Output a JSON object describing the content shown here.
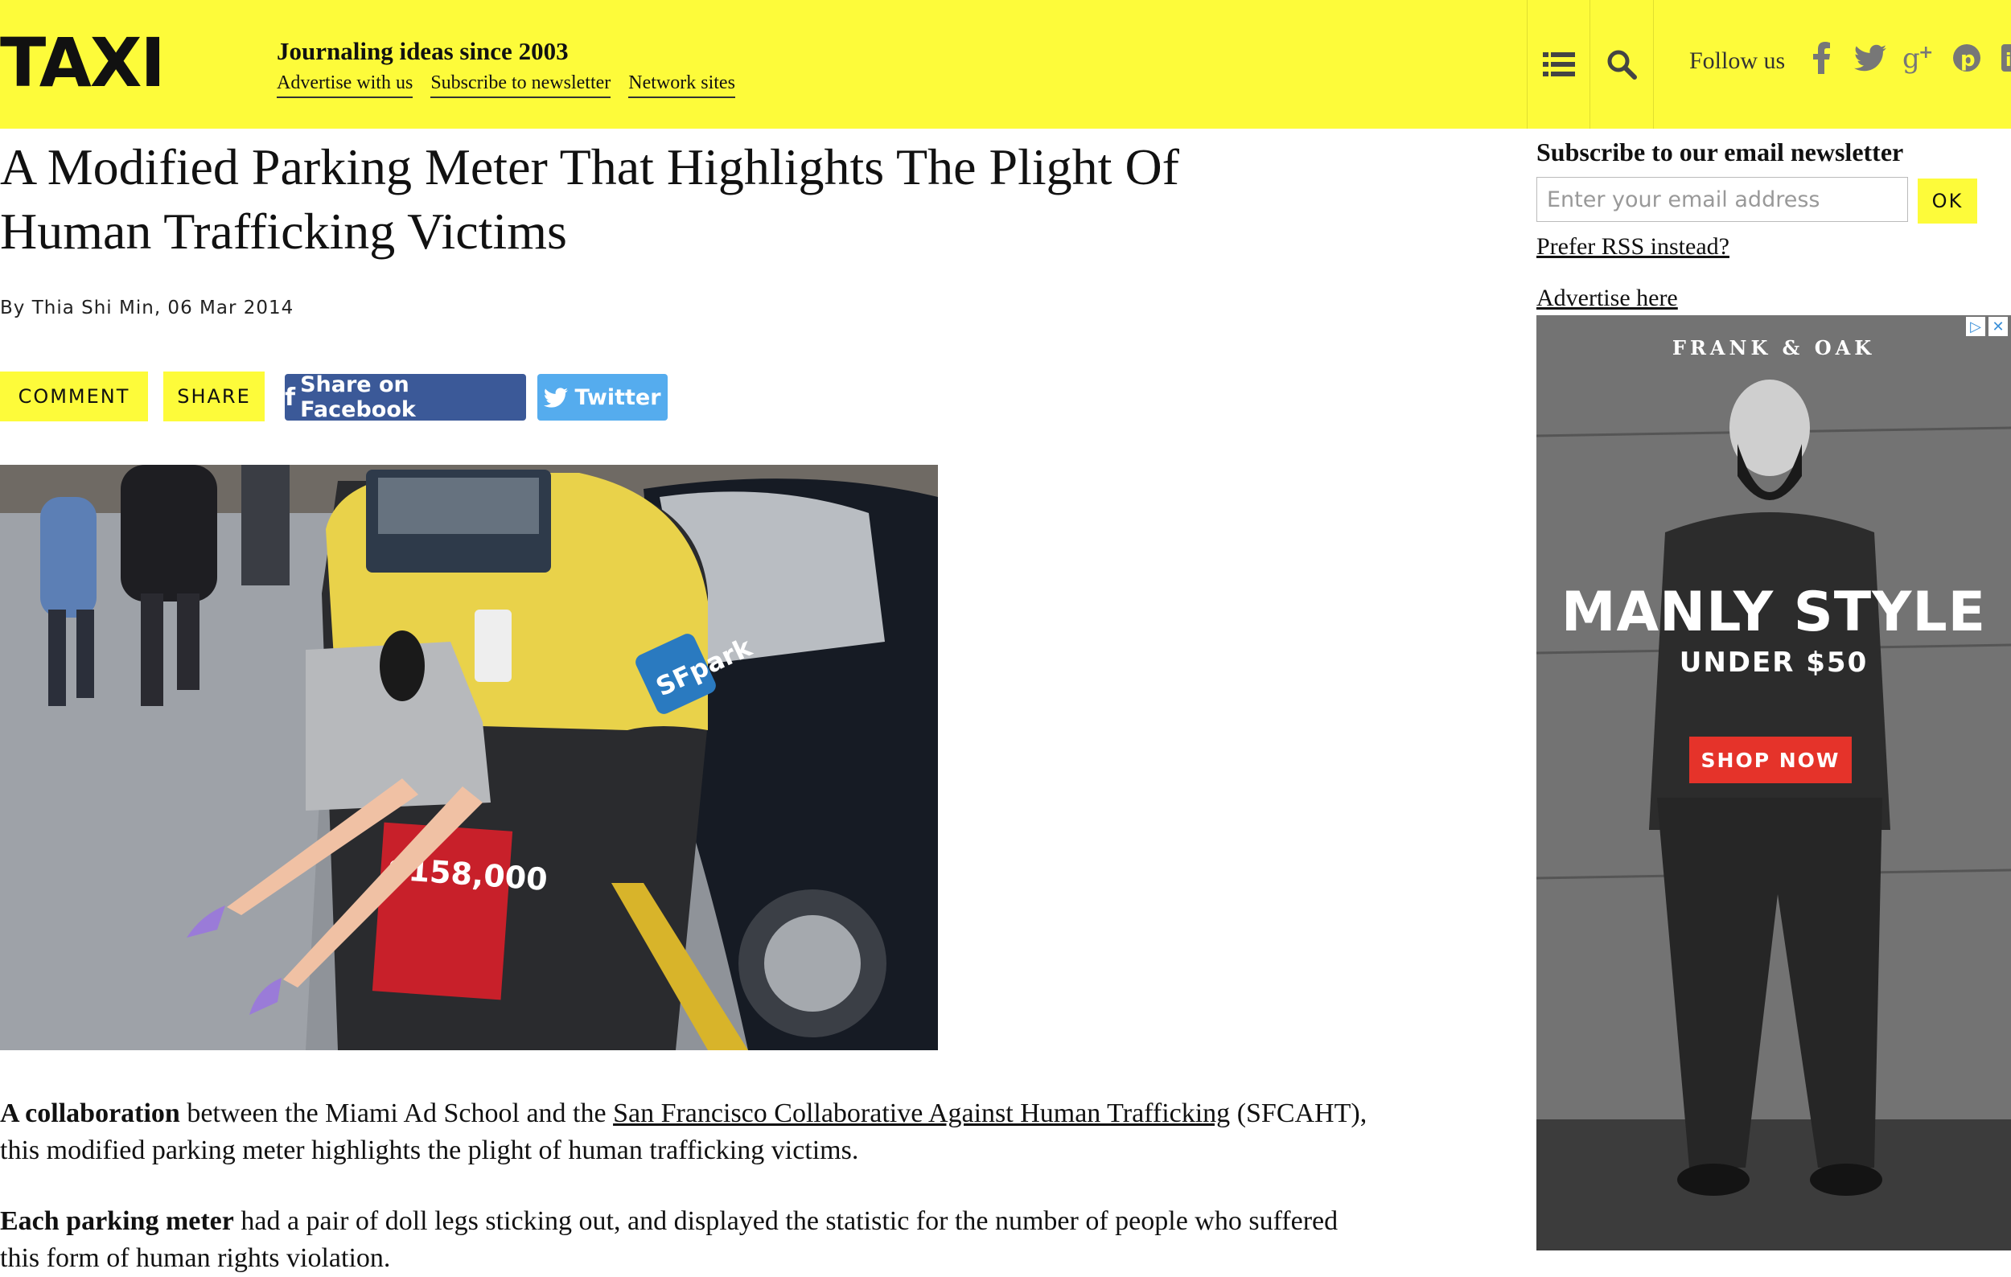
{
  "header": {
    "logo": "TAXI",
    "tagline": "Journaling ideas since 2003",
    "links": [
      "Advertise with us",
      "Subscribe to newsletter",
      "Network sites"
    ],
    "follow_label": "Follow us",
    "social_icons": [
      "facebook-icon",
      "twitter-icon",
      "google-plus-icon",
      "pinterest-icon",
      "linkedin-icon"
    ],
    "accent_color": "#fdfb3a"
  },
  "article": {
    "title": "A Modified Parking Meter That Highlights The Plight Of Human Trafficking Victims",
    "byline": "By Thia Shi Min, 06 Mar 2014",
    "buttons": {
      "comment": "COMMENT",
      "share": "SHARE",
      "facebook": "Share on Facebook",
      "twitter": "Twitter"
    },
    "image_text": {
      "meter_brand": "SFpark",
      "price_sign": "$158,000"
    },
    "para1": {
      "bold": "A collaboration",
      "text1": " between the Miami Ad School and the ",
      "link": "San Francisco Collaborative Against Human Trafficking",
      "text2": " (SFCAHT), this modified parking meter highlights the plight of human trafficking victims."
    },
    "para2": {
      "bold": "Each parking meter",
      "text": " had a pair of doll legs sticking out, and displayed the statistic for the number of people who suffered this form of human rights violation."
    }
  },
  "sidebar": {
    "subscribe_heading": "Subscribe to our email newsletter",
    "email_placeholder": "Enter your email address",
    "ok_label": "OK",
    "rss_link": "Prefer RSS instead?",
    "advertise_link": "Advertise here",
    "ad": {
      "brand": "FRANK & OAK",
      "headline": "MANLY STYLE",
      "subline": "UNDER $50",
      "cta": "SHOP NOW",
      "cta_color": "#e5332a"
    }
  }
}
